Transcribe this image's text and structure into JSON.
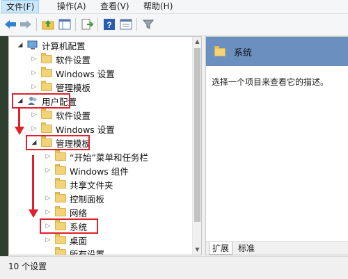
{
  "menu": {
    "file": "文件(F)",
    "action": "操作(A)",
    "view": "查看(V)",
    "help": "帮助(H)"
  },
  "toolbar": {
    "icons": [
      "back-icon",
      "forward-icon",
      "up-folder-icon",
      "show-hide-tree-icon",
      "export-list-icon",
      "help-icon",
      "properties-icon",
      "filter-icon"
    ]
  },
  "tree": {
    "computer_config": "计算机配置",
    "cc_software": "软件设置",
    "cc_windows": "Windows 设置",
    "cc_admin": "管理模板",
    "user_config": "用户配置",
    "uc_software": "软件设置",
    "uc_windows": "Windows 设置",
    "uc_admin": "管理模板",
    "start_menu": "“开始”菜单和任务栏",
    "windows_components": "Windows 组件",
    "shared_folders": "共享文件夹",
    "control_panel": "控制面板",
    "network": "网络",
    "system": "系统",
    "desktop": "桌面",
    "all_settings": "所有设置"
  },
  "right": {
    "header_title": "系统",
    "description": "选择一个项目来查看它的描述。"
  },
  "tabs": {
    "extended": "扩展",
    "standard": "标准"
  },
  "status": {
    "text": "10 个设置"
  },
  "colors": {
    "highlight_red": "#e0202a",
    "header_blue": "#6b8fbf",
    "folder_yellow": "#f3d37a"
  }
}
